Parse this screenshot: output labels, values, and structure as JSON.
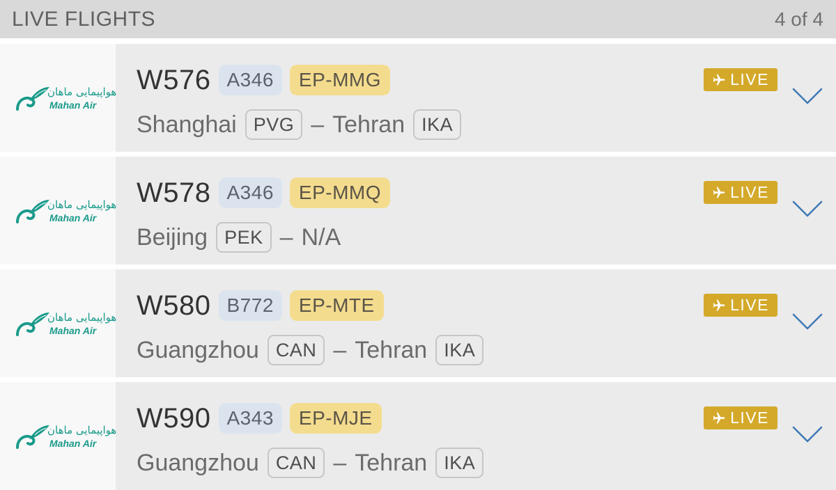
{
  "header": {
    "title": "LIVE FLIGHTS",
    "count": "4 of 4"
  },
  "airline": {
    "name_en": "Mahan Air",
    "name_fa": "هواپیمایی ماهان",
    "brand_color": "#1a9a8a"
  },
  "live_label": "LIVE",
  "colors": {
    "live_badge": "#d4a92a",
    "aircraft_badge": "#dbe4ee",
    "registration_badge": "#f4dc8e",
    "chevron": "#3f79b5"
  },
  "flights": [
    {
      "flight_number": "W576",
      "aircraft": "A346",
      "registration": "EP-MMG",
      "origin_city": "Shanghai",
      "origin_code": "PVG",
      "separator": "–",
      "destination_city": "Tehran",
      "destination_code": "IKA"
    },
    {
      "flight_number": "W578",
      "aircraft": "A346",
      "registration": "EP-MMQ",
      "origin_city": "Beijing",
      "origin_code": "PEK",
      "separator": "–",
      "destination_city": "N/A"
    },
    {
      "flight_number": "W580",
      "aircraft": "B772",
      "registration": "EP-MTE",
      "origin_city": "Guangzhou",
      "origin_code": "CAN",
      "separator": "–",
      "destination_city": "Tehran",
      "destination_code": "IKA"
    },
    {
      "flight_number": "W590",
      "aircraft": "A343",
      "registration": "EP-MJE",
      "origin_city": "Guangzhou",
      "origin_code": "CAN",
      "separator": "–",
      "destination_city": "Tehran",
      "destination_code": "IKA"
    }
  ]
}
